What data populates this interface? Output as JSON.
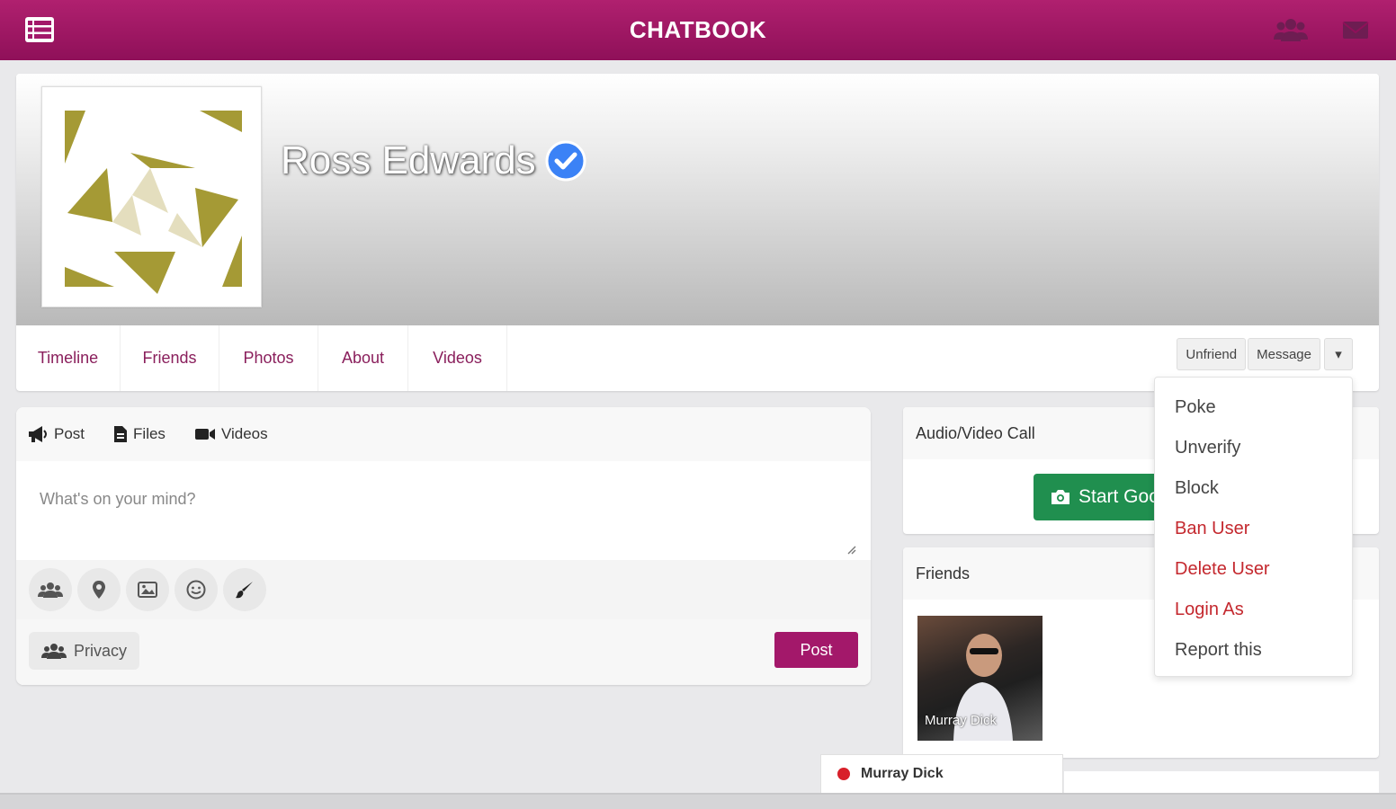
{
  "app": {
    "brand": "CHATBOOK"
  },
  "colors": {
    "brand": "#a3186a",
    "danger": "#c4282e",
    "success": "#208f4f",
    "verified": "#3b82f6"
  },
  "topbar_icons": [
    "menu-icon",
    "friends-icon",
    "mail-icon"
  ],
  "profile": {
    "name": "Ross Edwards",
    "verified": true
  },
  "tabs": [
    {
      "label": "Timeline"
    },
    {
      "label": "Friends"
    },
    {
      "label": "Photos"
    },
    {
      "label": "About"
    },
    {
      "label": "Videos"
    }
  ],
  "actions": {
    "unfriend": "Unfriend",
    "message": "Message",
    "more": "▾"
  },
  "dropdown": [
    {
      "label": "Poke",
      "danger": false
    },
    {
      "label": "Unverify",
      "danger": false
    },
    {
      "label": "Block",
      "danger": false
    },
    {
      "label": "Ban User",
      "danger": true
    },
    {
      "label": "Delete User",
      "danger": true
    },
    {
      "label": "Login As",
      "danger": true
    },
    {
      "label": "Report this",
      "danger": false
    }
  ],
  "composer": {
    "tabs": {
      "post": "Post",
      "files": "Files",
      "videos": "Videos"
    },
    "placeholder": "What's on your mind?",
    "tool_icons": [
      "tag-friends-icon",
      "location-icon",
      "photo-icon",
      "emoji-icon",
      "brush-icon"
    ],
    "privacy": "Privacy",
    "post": "Post"
  },
  "call": {
    "title": "Audio/Video Call",
    "button": "Start Goo"
  },
  "friends_widget": {
    "title": "Friends",
    "items": [
      {
        "name": "Murray Dick"
      }
    ]
  },
  "chat": {
    "name": "Murray Dick"
  }
}
